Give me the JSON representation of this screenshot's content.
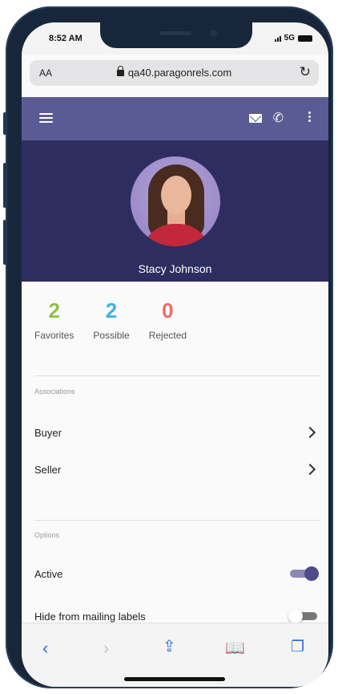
{
  "status_bar": {
    "time": "8:52 AM",
    "network": "5G"
  },
  "browser": {
    "text_size_label": "AA",
    "url": "qa40.paragonrels.com"
  },
  "profile": {
    "name": "Stacy Johnson"
  },
  "stats": [
    {
      "value": "2",
      "label": "Favorites",
      "color": "#8cc34a"
    },
    {
      "value": "2",
      "label": "Possible",
      "color": "#3fb3e6"
    },
    {
      "value": "0",
      "label": "Rejected",
      "color": "#ee6b64"
    }
  ],
  "associations": {
    "title": "Associations",
    "items": [
      {
        "label": "Buyer"
      },
      {
        "label": "Seller"
      }
    ]
  },
  "options": {
    "title": "Options",
    "items": [
      {
        "label": "Active",
        "enabled": true
      },
      {
        "label": "Hide from mailing labels",
        "enabled": false
      }
    ]
  },
  "colors": {
    "app_bar": "#5a5a94",
    "profile_header": "#2e2d60",
    "toolbar_accent": "#2f6ee0"
  },
  "icons": [
    "hamburger-icon",
    "mail-icon",
    "phone-icon",
    "more-icon",
    "chevron-right-icon",
    "back-icon",
    "forward-icon",
    "share-icon",
    "bookmarks-icon",
    "tabs-icon"
  ]
}
